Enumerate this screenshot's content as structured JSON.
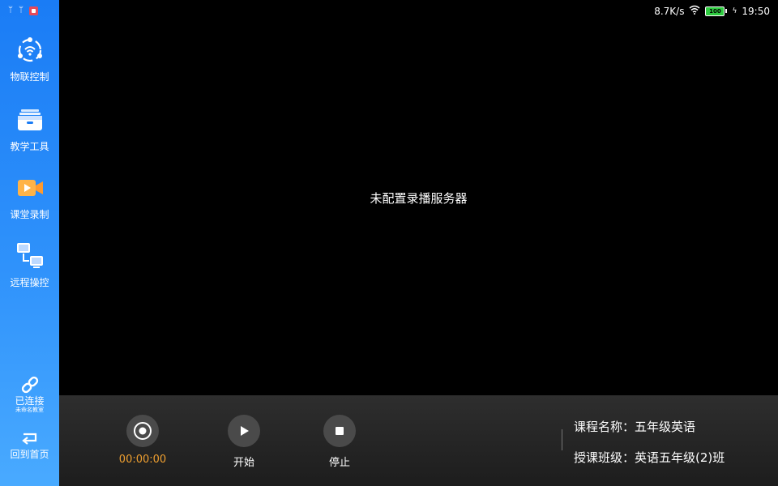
{
  "status_bar": {
    "net_speed": "8.7K/s",
    "battery": "100",
    "time": "19:50",
    "left_icons": [
      "usb-icon",
      "usb-icon",
      "screen-record-icon"
    ]
  },
  "sidebar": {
    "items": [
      {
        "label": "物联控制",
        "icon": "iot-control-icon"
      },
      {
        "label": "教学工具",
        "icon": "toolbox-icon"
      },
      {
        "label": "课堂录制",
        "icon": "video-camera-icon"
      },
      {
        "label": "远程操控",
        "icon": "remote-control-icon"
      }
    ],
    "connection": {
      "label": "已连接",
      "sub": "未命名教室",
      "icon": "link-icon"
    },
    "home": {
      "label": "回到首页",
      "icon": "return-icon"
    }
  },
  "main": {
    "message": "未配置录播服务器"
  },
  "controls": {
    "record": {
      "timer": "00:00:00",
      "icon": "record-icon"
    },
    "start": {
      "label": "开始",
      "icon": "play-icon"
    },
    "stop": {
      "label": "停止",
      "icon": "stop-icon"
    }
  },
  "course_info": {
    "name_label": "课程名称：",
    "name_value": "五年级英语",
    "class_label": "授课班级：",
    "class_value": "英语五年级(2)班"
  },
  "colors": {
    "sidebar_top": "#1a7cf5",
    "sidebar_bottom": "#49aaff",
    "timer": "#f0a030",
    "battery": "#2ecc40"
  }
}
